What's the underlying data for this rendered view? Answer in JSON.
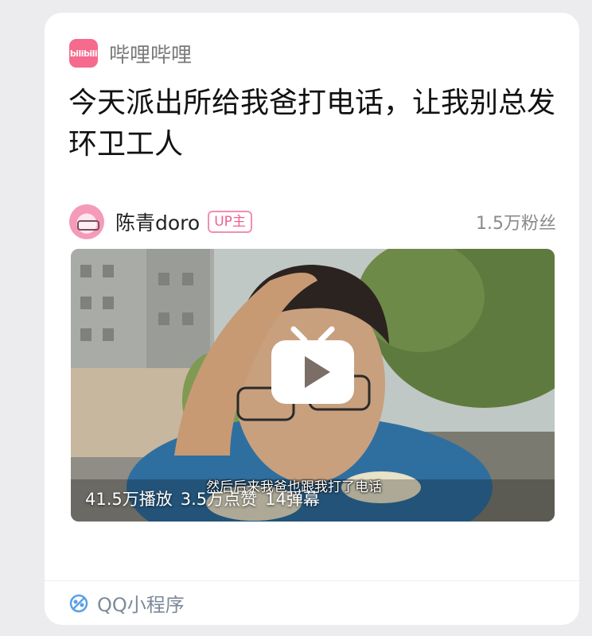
{
  "app": {
    "name": "哔哩哔哩",
    "logo_text": "bilibili",
    "logo_color": "#f56a8d"
  },
  "post": {
    "title": "今天派出所给我爸打电话，让我别总发环卫工人"
  },
  "author": {
    "name": "陈青doro",
    "badge": "UP主",
    "fans": "1.5万粉丝"
  },
  "video": {
    "subtitle": "然后后来我爸也跟我打了电话",
    "stats": {
      "plays": "41.5万播放",
      "likes": "3.5万点赞",
      "danmaku": "14弹幕"
    }
  },
  "footer": {
    "label": "QQ小程序",
    "icon": "qq-miniprogram-icon"
  }
}
